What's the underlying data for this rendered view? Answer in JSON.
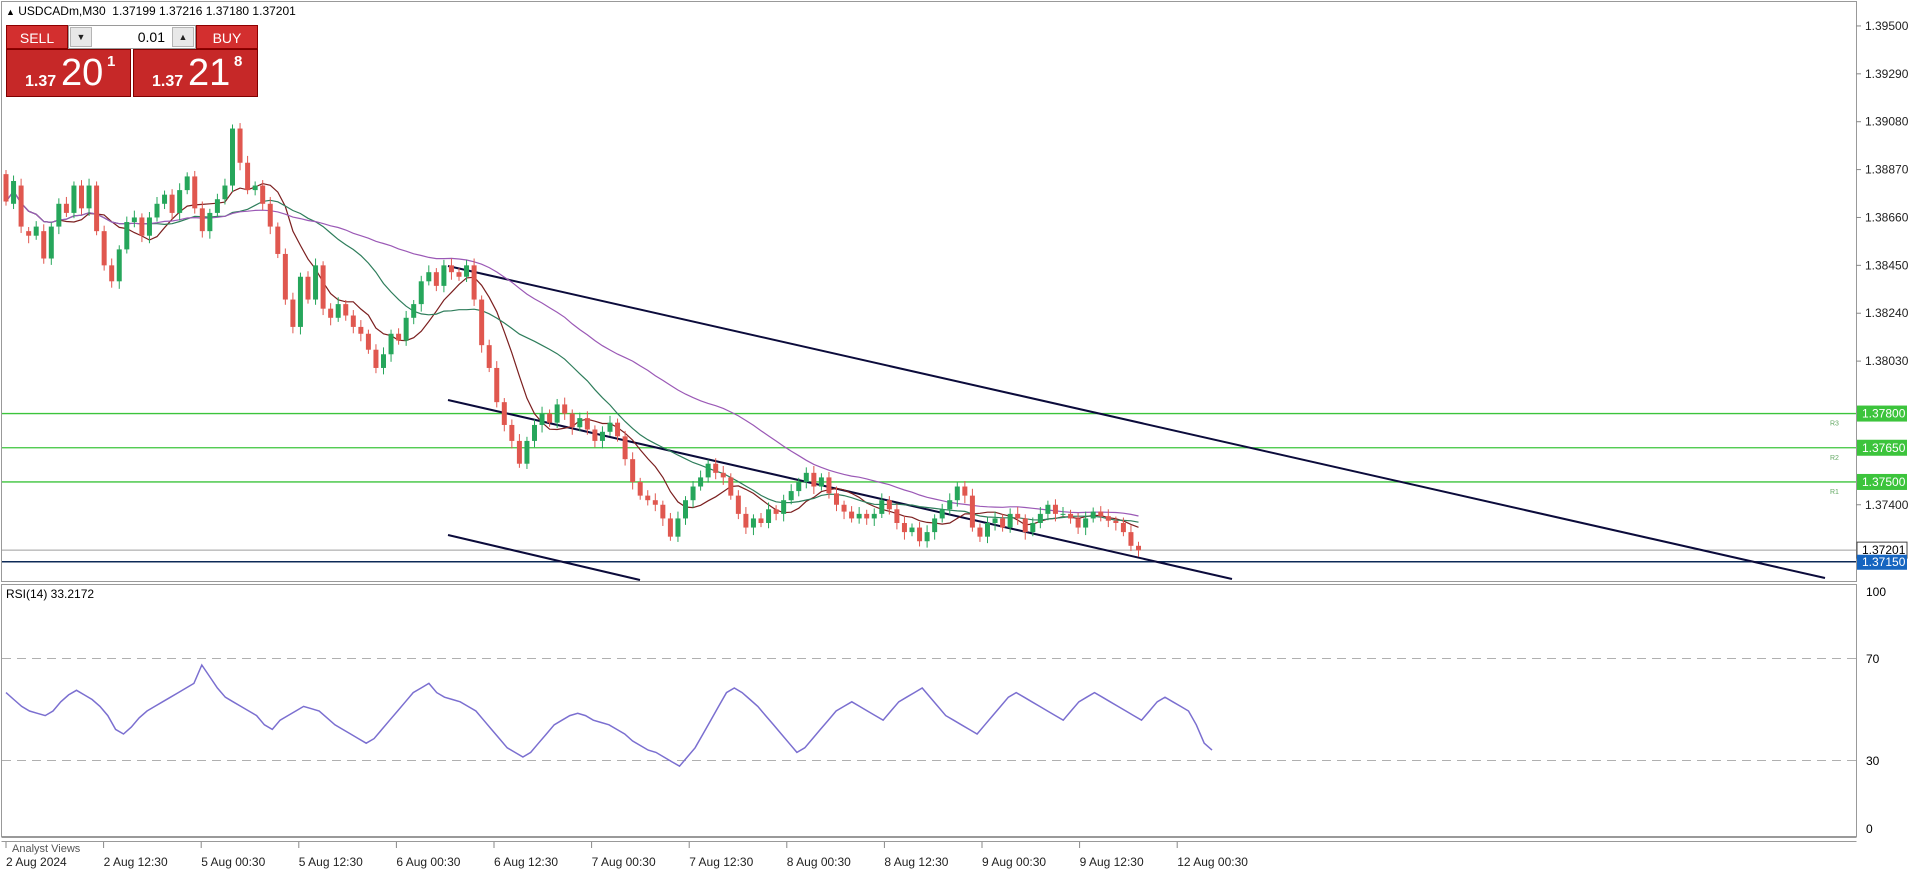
{
  "header": {
    "symbol_timeframe": "USDCADm,M30",
    "ohlc": "1.37199 1.37216 1.37180 1.37201"
  },
  "trade_panel": {
    "sell_label": "SELL",
    "buy_label": "BUY",
    "lot": "0.01",
    "sell_price": {
      "small": "1.37",
      "big": "20",
      "sup": "1"
    },
    "buy_price": {
      "small": "1.37",
      "big": "21",
      "sup": "8"
    }
  },
  "price_axis": {
    "ticks": [
      "1.39500",
      "1.39290",
      "1.39080",
      "1.38870",
      "1.38660",
      "1.38450",
      "1.38240",
      "1.38030",
      "1.37400"
    ],
    "min": 1.3707,
    "max": 1.39605
  },
  "levels": {
    "r3": {
      "price": 1.378,
      "label": "1.37800",
      "tag": "R3"
    },
    "r2": {
      "price": 1.3765,
      "label": "1.37650",
      "tag": "R2"
    },
    "r1": {
      "price": 1.375,
      "label": "1.37500",
      "tag": "R1"
    },
    "current": {
      "price": 1.37201,
      "label": "1.37201"
    },
    "support": {
      "price": 1.3715,
      "label": "1.37150"
    }
  },
  "rsi": {
    "label": "RSI(14) 33.2172",
    "ticks": [
      "100",
      "70",
      "30",
      "0"
    ],
    "current": 33.2172
  },
  "time_axis": {
    "labels": [
      "2 Aug 2024",
      "2 Aug 12:30",
      "5 Aug 00:30",
      "5 Aug 12:30",
      "6 Aug 00:30",
      "6 Aug 12:30",
      "7 Aug 00:30",
      "7 Aug 12:30",
      "8 Aug 00:30",
      "8 Aug 12:30",
      "9 Aug 00:30",
      "9 Aug 12:30",
      "12 Aug 00:30"
    ]
  },
  "analyst_views": "Analyst Views",
  "colors": {
    "bull": "#26a65b",
    "bear": "#e0574f",
    "ma_fast": "#7b1f1f",
    "ma_mid": "#2e7d5b",
    "ma_slow": "#9b59b6",
    "level": "#3cc43c",
    "channel": "#0b0b3b",
    "rsi": "#7b6fd0",
    "axis_badge": "#1565c0"
  },
  "chart_data": {
    "type": "candlestick",
    "candles": [
      [
        1.3885,
        1.3873
      ],
      [
        1.3872,
        1.3882
      ],
      [
        1.388,
        1.3862
      ],
      [
        1.386,
        1.3858
      ],
      [
        1.3858,
        1.3862
      ],
      [
        1.386,
        1.3848
      ],
      [
        1.3848,
        1.3862
      ],
      [
        1.3862,
        1.3872
      ],
      [
        1.3872,
        1.3868
      ],
      [
        1.3868,
        1.388
      ],
      [
        1.388,
        1.387
      ],
      [
        1.387,
        1.388
      ],
      [
        1.388,
        1.386
      ],
      [
        1.386,
        1.3845
      ],
      [
        1.3845,
        1.3838
      ],
      [
        1.3838,
        1.3852
      ],
      [
        1.3852,
        1.3864
      ],
      [
        1.3864,
        1.3866
      ],
      [
        1.3866,
        1.3858
      ],
      [
        1.3858,
        1.3866
      ],
      [
        1.3866,
        1.3872
      ],
      [
        1.3872,
        1.3876
      ],
      [
        1.3876,
        1.3868
      ],
      [
        1.3868,
        1.3878
      ],
      [
        1.3878,
        1.3884
      ],
      [
        1.3884,
        1.387
      ],
      [
        1.387,
        1.386
      ],
      [
        1.386,
        1.3868
      ],
      [
        1.3868,
        1.3874
      ],
      [
        1.3874,
        1.388
      ],
      [
        1.388,
        1.3905
      ],
      [
        1.3905,
        1.389
      ],
      [
        1.389,
        1.3878
      ],
      [
        1.3878,
        1.388
      ],
      [
        1.388,
        1.3872
      ],
      [
        1.3872,
        1.3862
      ],
      [
        1.3862,
        1.385
      ],
      [
        1.385,
        1.383
      ],
      [
        1.383,
        1.3818
      ],
      [
        1.3818,
        1.384
      ],
      [
        1.384,
        1.383
      ],
      [
        1.383,
        1.3845
      ],
      [
        1.3845,
        1.3826
      ],
      [
        1.3826,
        1.3822
      ],
      [
        1.3822,
        1.3828
      ],
      [
        1.3828,
        1.3823
      ],
      [
        1.3823,
        1.3818
      ],
      [
        1.3818,
        1.3815
      ],
      [
        1.3815,
        1.3808
      ],
      [
        1.3808,
        1.38
      ],
      [
        1.38,
        1.3806
      ],
      [
        1.3806,
        1.3815
      ],
      [
        1.3815,
        1.3812
      ],
      [
        1.3812,
        1.3822
      ],
      [
        1.3822,
        1.3828
      ],
      [
        1.3828,
        1.3838
      ],
      [
        1.3838,
        1.3842
      ],
      [
        1.3842,
        1.3836
      ],
      [
        1.3836,
        1.3845
      ],
      [
        1.3845,
        1.3842
      ],
      [
        1.3842,
        1.384
      ],
      [
        1.384,
        1.3845
      ],
      [
        1.3845,
        1.383
      ],
      [
        1.383,
        1.381
      ],
      [
        1.381,
        1.38
      ],
      [
        1.38,
        1.3785
      ],
      [
        1.3785,
        1.3775
      ],
      [
        1.3775,
        1.3768
      ],
      [
        1.3768,
        1.3758
      ],
      [
        1.3758,
        1.3768
      ],
      [
        1.3768,
        1.3775
      ],
      [
        1.3775,
        1.378
      ],
      [
        1.378,
        1.3776
      ],
      [
        1.3776,
        1.3784
      ],
      [
        1.3784,
        1.378
      ],
      [
        1.378,
        1.3774
      ],
      [
        1.3774,
        1.3778
      ],
      [
        1.3778,
        1.3773
      ],
      [
        1.3773,
        1.3768
      ],
      [
        1.3768,
        1.3772
      ],
      [
        1.3772,
        1.3776
      ],
      [
        1.3776,
        1.377
      ],
      [
        1.377,
        1.376
      ],
      [
        1.376,
        1.375
      ],
      [
        1.375,
        1.3744
      ],
      [
        1.3744,
        1.3742
      ],
      [
        1.3742,
        1.374
      ],
      [
        1.374,
        1.3734
      ],
      [
        1.3734,
        1.3726
      ],
      [
        1.3726,
        1.3734
      ],
      [
        1.3734,
        1.3742
      ],
      [
        1.3742,
        1.3748
      ],
      [
        1.3748,
        1.3752
      ],
      [
        1.3752,
        1.3758
      ],
      [
        1.3758,
        1.3754
      ],
      [
        1.3754,
        1.3752
      ],
      [
        1.3752,
        1.3744
      ],
      [
        1.3744,
        1.3736
      ],
      [
        1.3736,
        1.373
      ],
      [
        1.373,
        1.3734
      ],
      [
        1.3734,
        1.3732
      ],
      [
        1.3732,
        1.3738
      ],
      [
        1.3738,
        1.3736
      ],
      [
        1.3736,
        1.3742
      ],
      [
        1.3742,
        1.3746
      ],
      [
        1.3746,
        1.375
      ],
      [
        1.375,
        1.3754
      ],
      [
        1.3754,
        1.3748
      ],
      [
        1.3748,
        1.3752
      ],
      [
        1.3752,
        1.3745
      ],
      [
        1.3745,
        1.374
      ],
      [
        1.374,
        1.3737
      ],
      [
        1.3737,
        1.3734
      ],
      [
        1.3734,
        1.3736
      ],
      [
        1.3736,
        1.3734
      ],
      [
        1.3734,
        1.3736
      ],
      [
        1.3736,
        1.3742
      ],
      [
        1.3742,
        1.3738
      ],
      [
        1.3738,
        1.3732
      ],
      [
        1.3732,
        1.3728
      ],
      [
        1.3728,
        1.373
      ],
      [
        1.373,
        1.3724
      ],
      [
        1.3724,
        1.3728
      ],
      [
        1.3728,
        1.3734
      ],
      [
        1.3734,
        1.3738
      ],
      [
        1.3738,
        1.3742
      ],
      [
        1.3742,
        1.3748
      ],
      [
        1.3748,
        1.3744
      ],
      [
        1.3744,
        1.373
      ],
      [
        1.373,
        1.3726
      ],
      [
        1.3726,
        1.3732
      ],
      [
        1.3732,
        1.3734
      ],
      [
        1.3734,
        1.373
      ],
      [
        1.373,
        1.3736
      ],
      [
        1.3736,
        1.3734
      ],
      [
        1.3734,
        1.3728
      ],
      [
        1.3728,
        1.3732
      ],
      [
        1.3732,
        1.3736
      ],
      [
        1.3736,
        1.374
      ],
      [
        1.374,
        1.3736
      ],
      [
        1.3736,
        1.3736
      ],
      [
        1.3736,
        1.3734
      ],
      [
        1.3734,
        1.373
      ],
      [
        1.373,
        1.3734
      ],
      [
        1.3734,
        1.3737
      ],
      [
        1.3737,
        1.3735
      ],
      [
        1.3735,
        1.3733
      ],
      [
        1.3733,
        1.3732
      ],
      [
        1.3732,
        1.3728
      ],
      [
        1.3728,
        1.3722
      ],
      [
        1.3722,
        1.372
      ]
    ],
    "rsi": [
      58,
      55,
      52,
      50,
      49,
      48,
      50,
      54,
      57,
      59,
      57,
      55,
      52,
      48,
      42,
      40,
      43,
      47,
      50,
      52,
      54,
      56,
      58,
      60,
      62,
      70,
      65,
      60,
      56,
      54,
      52,
      50,
      48,
      44,
      42,
      46,
      48,
      50,
      52,
      51,
      50,
      47,
      44,
      42,
      40,
      38,
      36,
      38,
      42,
      46,
      50,
      54,
      58,
      60,
      62,
      58,
      56,
      55,
      54,
      52,
      50,
      46,
      42,
      38,
      34,
      32,
      30,
      32,
      36,
      40,
      44,
      46,
      48,
      49,
      48,
      46,
      45,
      44,
      42,
      40,
      37,
      35,
      33,
      32,
      30,
      28,
      26,
      30,
      34,
      40,
      46,
      52,
      58,
      60,
      58,
      55,
      52,
      48,
      44,
      40,
      36,
      32,
      34,
      38,
      42,
      46,
      50,
      52,
      54,
      52,
      50,
      48,
      46,
      50,
      54,
      56,
      58,
      60,
      56,
      52,
      48,
      46,
      44,
      42,
      40,
      44,
      48,
      52,
      56,
      58,
      56,
      54,
      52,
      50,
      48,
      46,
      50,
      54,
      56,
      58,
      56,
      54,
      52,
      50,
      48,
      46,
      50,
      54,
      56,
      54,
      52,
      50,
      44,
      36,
      33
    ]
  }
}
